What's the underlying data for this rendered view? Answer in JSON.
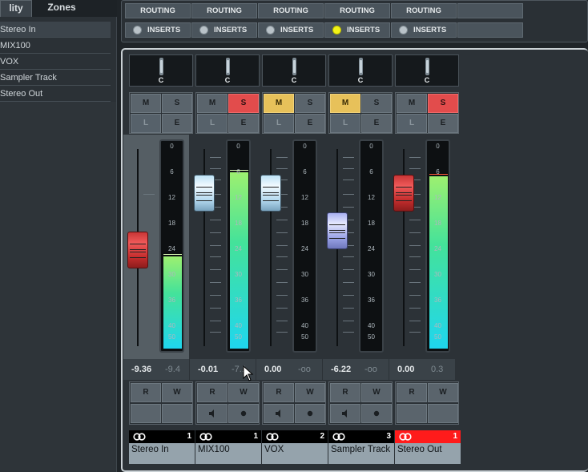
{
  "left_panel": {
    "tabs": [
      {
        "label": "lity"
      },
      {
        "label": "Zones"
      }
    ],
    "tracks": [
      {
        "label": "Stereo In"
      },
      {
        "label": "MIX100"
      },
      {
        "label": "VOX"
      },
      {
        "label": "Sampler Track"
      },
      {
        "label": "Stereo Out"
      }
    ]
  },
  "top_strip": {
    "routing_label": "ROUTING",
    "inserts_label": "INSERTS",
    "insert_leds": [
      "off",
      "off",
      "off",
      "on",
      "off"
    ]
  },
  "buttons": {
    "mute": "M",
    "solo": "S",
    "listen": "L",
    "edit": "E",
    "read": "R",
    "write": "W",
    "pan": "C"
  },
  "meter_scale": [
    "0",
    "6",
    "12",
    "18",
    "24",
    "30",
    "36",
    "40",
    "50"
  ],
  "channels": [
    {
      "name": "Stereo In",
      "number": "1",
      "volume": "-9.36",
      "peak": "-9.4",
      "fader_db": -9.36,
      "meter_level": 0.45,
      "mute": false,
      "solo": false,
      "fader_color": "red",
      "namebar": "black",
      "show_monitor": false
    },
    {
      "name": "MIX100",
      "number": "1",
      "volume": "-0.01",
      "peak": "-7.1",
      "fader_db": -0.01,
      "meter_level": 0.86,
      "mute": false,
      "solo": true,
      "fader_color": "ice",
      "namebar": "black",
      "show_monitor": true
    },
    {
      "name": "VOX",
      "number": "2",
      "volume": "0.00",
      "peak": "-oo",
      "fader_db": 0.0,
      "meter_level": 0.0,
      "mute": true,
      "solo": false,
      "fader_color": "ice",
      "namebar": "black",
      "show_monitor": true
    },
    {
      "name": "Sampler Track",
      "number": "3",
      "volume": "-6.22",
      "peak": "-oo",
      "fader_db": -6.22,
      "meter_level": 0.0,
      "mute": true,
      "solo": false,
      "fader_color": "violet",
      "namebar": "black",
      "show_monitor": true
    },
    {
      "name": "Stereo Out",
      "number": "1",
      "volume": "0.00",
      "peak": "0.3",
      "fader_db": 0.0,
      "meter_level": 0.84,
      "mute": false,
      "solo": true,
      "fader_color": "red",
      "namebar": "red",
      "show_monitor": false
    }
  ]
}
